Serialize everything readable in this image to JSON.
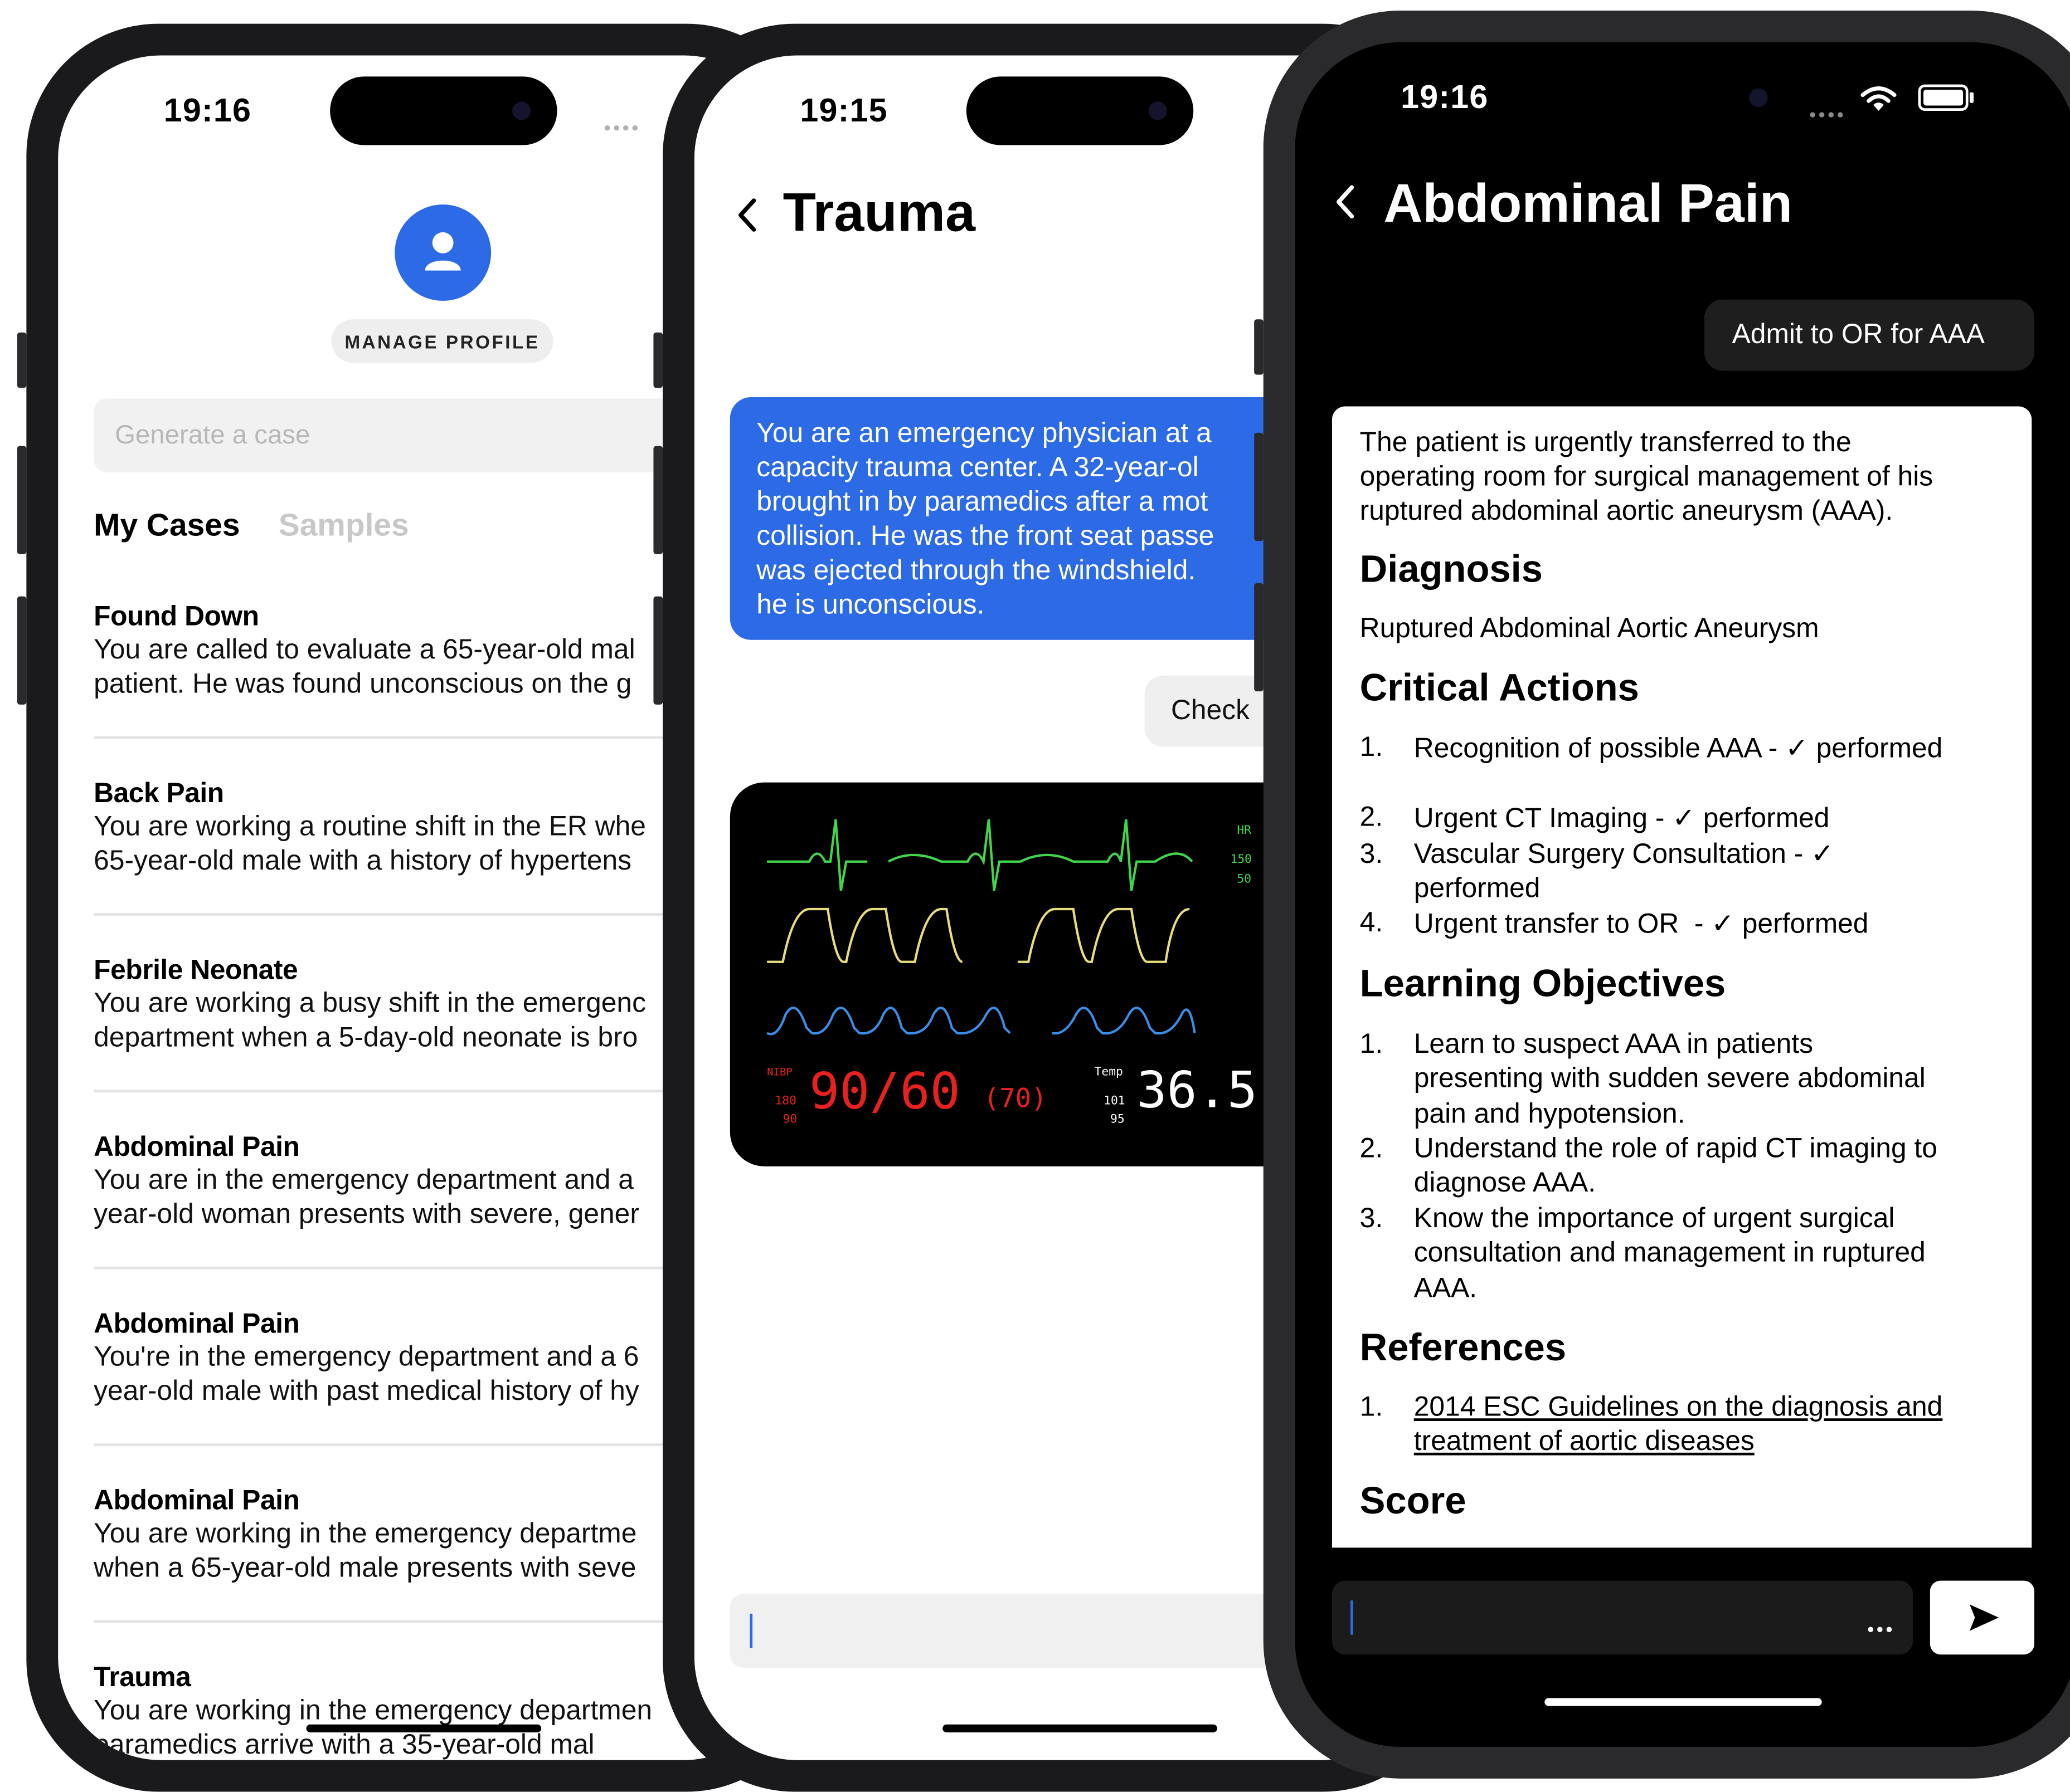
{
  "colors": {
    "accent": "#2d6ae6",
    "monitor_green": "#41d64a",
    "monitor_yellow": "#e8dc7c",
    "monitor_blue": "#3a8ee8",
    "monitor_red": "#e82020"
  },
  "phone1": {
    "time": "19:16",
    "profile_button": "MANAGE PROFILE",
    "search_placeholder": "Generate a case",
    "tabs": {
      "active": "My Cases",
      "inactive": "Samples"
    },
    "cases": [
      {
        "title": "Found Down",
        "line1": "You are called to evaluate a 65-year-old mal",
        "line2": "patient. He was found unconscious on the g"
      },
      {
        "title": "Back Pain",
        "line1": "You are working a routine shift in the ER whe",
        "line2": "65-year-old male with a history of hypertens"
      },
      {
        "title": "Febrile Neonate",
        "line1": "You are working a busy shift in the emergenc",
        "line2": "department when a 5-day-old neonate is bro"
      },
      {
        "title": "Abdominal Pain",
        "line1": "You are in the emergency department and a",
        "line2": "year-old woman presents with severe, gener"
      },
      {
        "title": "Abdominal Pain",
        "line1": "You're in the emergency department and a 6",
        "line2": "year-old male with past medical history of hy"
      },
      {
        "title": "Abdominal Pain",
        "line1": "You are working in the emergency departme",
        "line2": "when a 65-year-old male presents with seve"
      },
      {
        "title": "Trauma",
        "line1": "You are working in the emergency departmen",
        "line2": "paramedics arrive with a 35-year-old mal"
      }
    ]
  },
  "phone2": {
    "time": "19:15",
    "back_icon": "chevron-left-icon",
    "title": "Trauma",
    "message_lines": [
      "You are an emergency physician at a",
      "capacity trauma center. A 32-year-ol",
      "brought in by paramedics after a mot",
      "collision. He was the front seat passe",
      "was ejected through the windshield.",
      "he is unconscious."
    ],
    "check_button": "Check",
    "monitor": {
      "hr_label": "HR",
      "hr_high": "150",
      "hr_low": "50",
      "nibp_label": "NIBP",
      "nibp_high": "180",
      "nibp_low": "90",
      "bp_value": "90/60",
      "map_value": "(70)",
      "temp_label": "Temp",
      "temp_high": "101",
      "temp_low": "95",
      "temp_value": "36.5"
    }
  },
  "phone3": {
    "time": "19:16",
    "title": "Abdominal Pain",
    "action_button": "Admit to OR for AAA",
    "intro_lines": [
      "The patient is urgently transferred to the",
      "operating room for surgical management of his",
      "ruptured abdominal aortic aneurysm (AAA)."
    ],
    "diagnosis_heading": "Diagnosis",
    "diagnosis": "Ruptured Abdominal Aortic Aneurysm",
    "critical_heading": "Critical Actions",
    "critical_actions": [
      {
        "num": "1.",
        "lines": [
          "Recognition of possible AAA - ✓ performed"
        ]
      },
      {
        "num": "2.",
        "lines": [
          "Urgent CT Imaging - ✓ performed"
        ]
      },
      {
        "num": "3.",
        "lines": [
          "Vascular Surgery Consultation - ✓",
          "performed"
        ]
      },
      {
        "num": "4.",
        "lines": [
          "Urgent transfer to OR  - ✓ performed"
        ]
      }
    ],
    "learning_heading": "Learning Objectives",
    "learning_objectives": [
      {
        "num": "1.",
        "lines": [
          "Learn to suspect AAA in patients",
          "presenting with sudden severe abdominal",
          "pain and hypotension."
        ]
      },
      {
        "num": "2.",
        "lines": [
          "Understand the role of rapid CT imaging to",
          "diagnose AAA."
        ]
      },
      {
        "num": "3.",
        "lines": [
          "Know the importance of urgent surgical",
          "consultation and management in ruptured",
          "AAA."
        ]
      }
    ],
    "references_heading": "References",
    "references": [
      {
        "num": "1.",
        "lines": [
          "2014 ESC Guidelines on the diagnosis and",
          "treatment of aortic diseases"
        ]
      }
    ],
    "score_heading": "Score",
    "more_icon": "ellipsis-icon",
    "send_icon": "send-icon"
  }
}
